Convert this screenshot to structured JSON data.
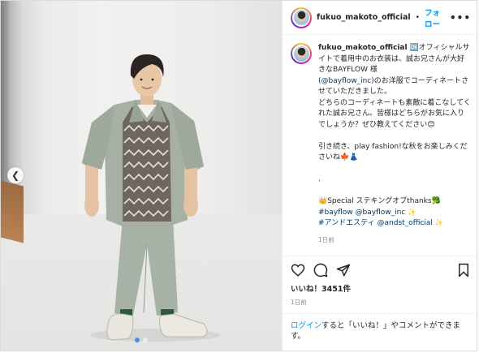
{
  "post": {
    "username": "fukuo_makoto_official",
    "separator": "•",
    "follow_label": "フォロー",
    "more_label": "•••"
  },
  "caption": {
    "username": "fukuo_makoto_official",
    "line1": "🆗オフィシャルサイトで着用中のお衣装は、誠お兄さんが大好きなBAYFLOW 様",
    "line2_link": "(@bayflow_inc)",
    "line2_rest": "のお洋服でコーディネートさせていただきました。",
    "line3": "どちらのコーディネートも素敵に着こなしてくれた誠お兄さん。皆様はどちらがお気に入りでしょうか？ぜひ教えてください😊",
    "line4": "引き続き、play fashion!な秋をお楽しみくださいね🍁👗",
    "dot": ".",
    "special": "👑Special ステキングオブthanks🥦",
    "tag1": "#bayflow",
    "mention1": "@bayflow_inc",
    "emoji1": "✨",
    "tag2": "#アンドエスティ",
    "mention2": "@andst_official",
    "emoji2": "✨",
    "time": "1日前"
  },
  "actions": {
    "like_icon": "heart-icon",
    "comment_icon": "comment-icon",
    "share_icon": "share-icon",
    "save_icon": "bookmark-icon"
  },
  "likes": "いいね！3451件",
  "date": "1日前",
  "login": {
    "link": "ログイン",
    "rest": "すると「いいね！」やコメントができます。"
  },
  "colors": {
    "accent": "#0095f6",
    "carousel_dot_active": "#4a90e2"
  }
}
